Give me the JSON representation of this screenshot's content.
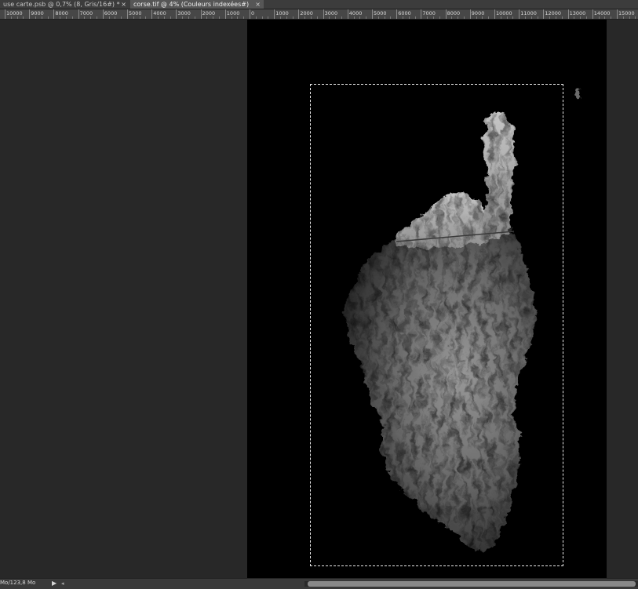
{
  "tabs": [
    {
      "label": "use carte.psb @ 0,7% (8, Gris/16#) *",
      "close": "×",
      "active": false
    },
    {
      "label": "corse.tif @ 4% (Couleurs indexées#)",
      "close": "×",
      "active": true
    }
  ],
  "ruler": {
    "labels": [
      "10000",
      "9000",
      "8000",
      "7000",
      "6000",
      "5000",
      "4000",
      "3000",
      "2000",
      "1000",
      "0",
      "1000",
      "2000",
      "3000",
      "4000",
      "5000",
      "6000",
      "7000",
      "8000",
      "9000",
      "10000",
      "11000",
      "12000",
      "13000",
      "14000",
      "15000"
    ]
  },
  "status": {
    "doc_size": "Mo/123,8 Mo",
    "arrow": "▶",
    "scroll_left": "◂"
  },
  "colors": {
    "workspace": "#282828",
    "canvas": "#000000",
    "terrain": "#bdbdbd"
  }
}
